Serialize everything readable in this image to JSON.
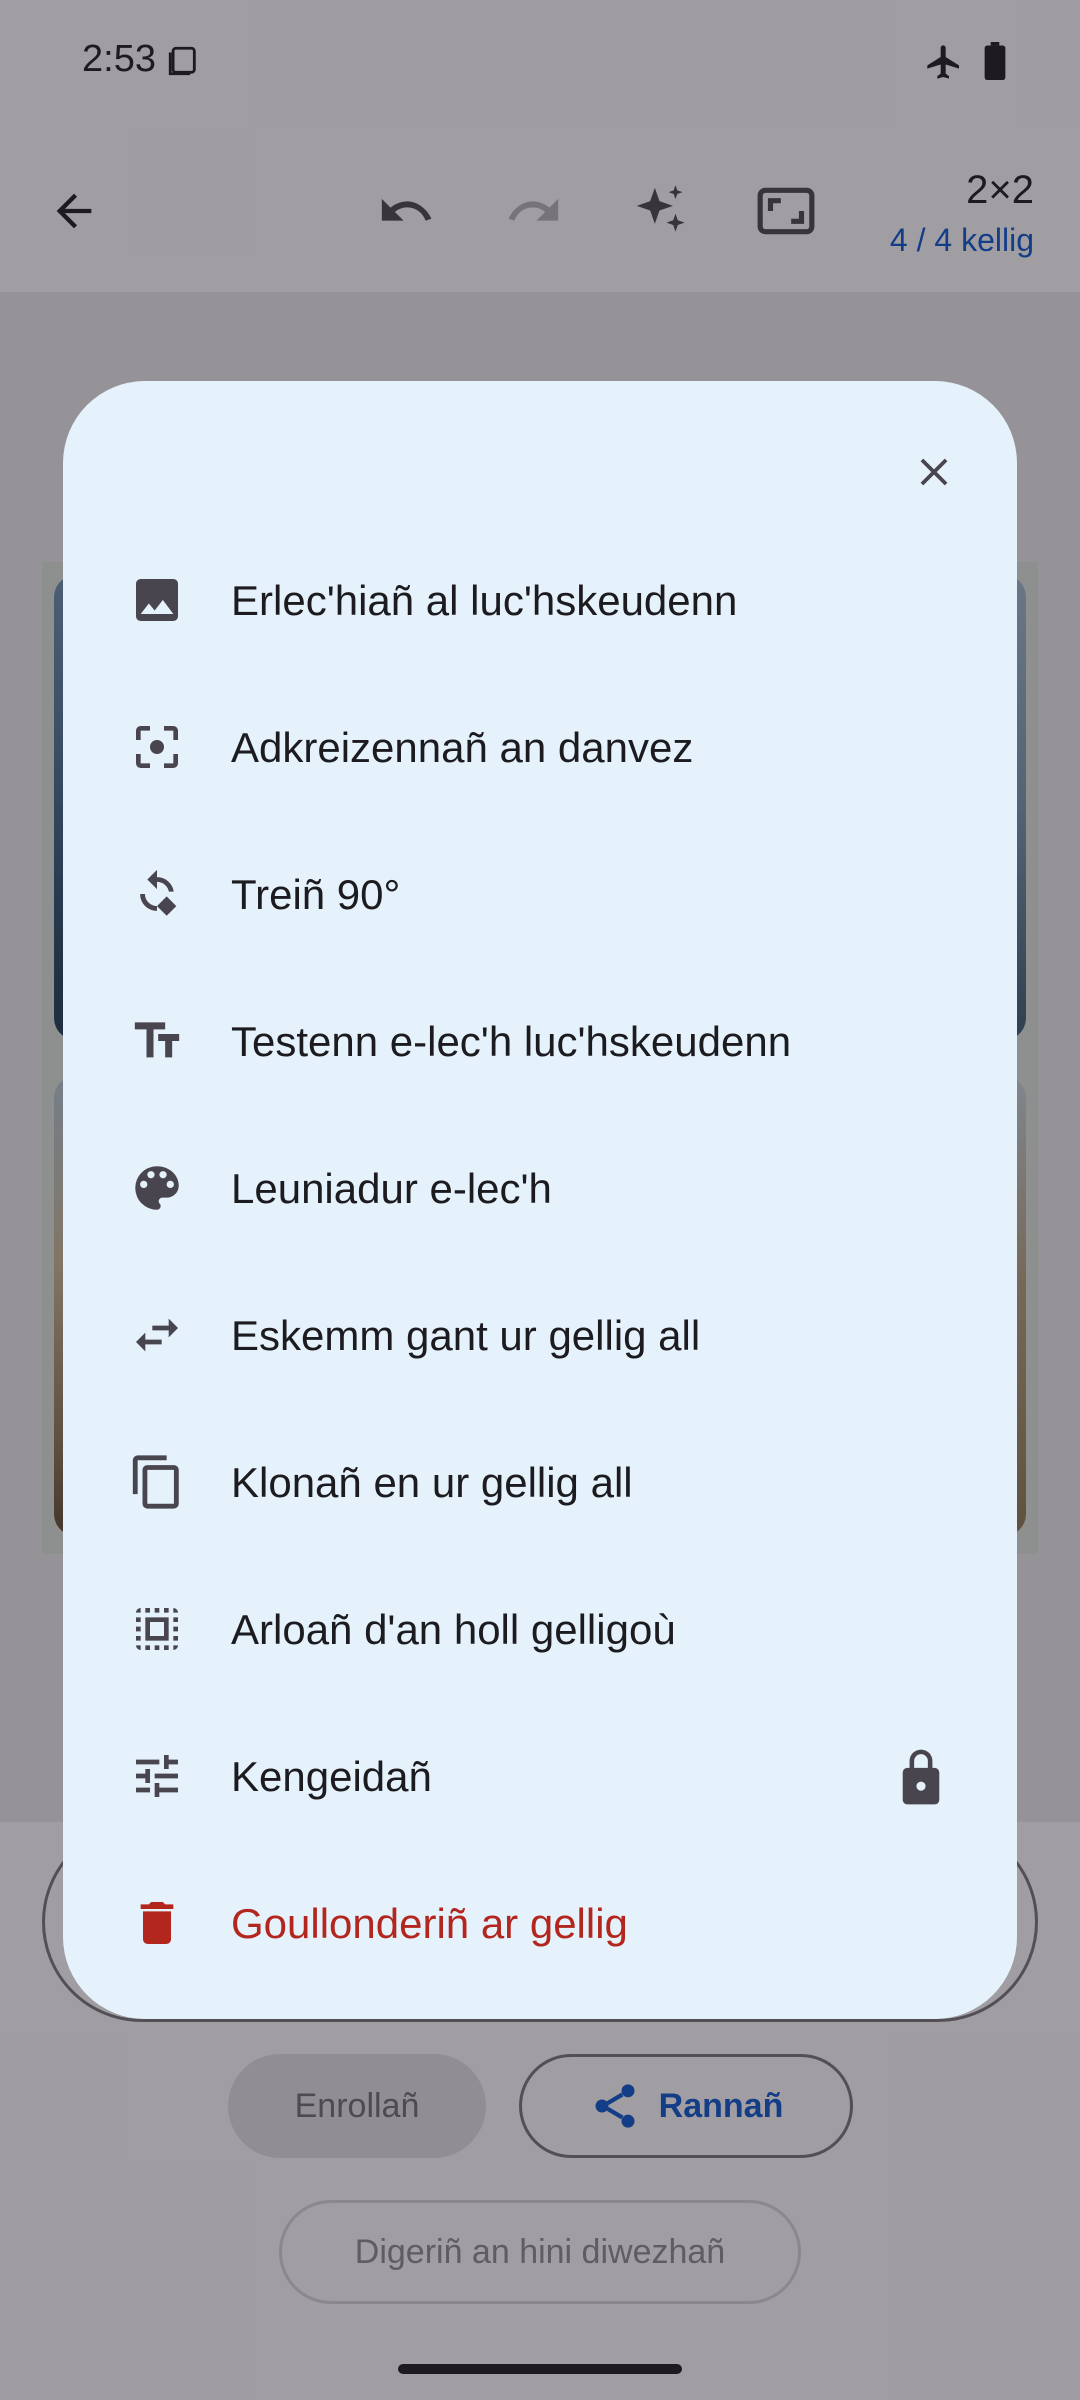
{
  "status_bar": {
    "time": "2:53",
    "icons": [
      "notification-icon",
      "airplane-mode-icon",
      "battery-icon"
    ]
  },
  "toolbar": {
    "back_icon": "arrow-back-icon",
    "undo_icon": "undo-icon",
    "redo_icon": "redo-icon",
    "magic_icon": "sparkle-icon",
    "aspect_icon": "aspect-ratio-icon",
    "grid_size": "2×2",
    "cell_count": "4 / 4 kellig"
  },
  "bottom_actions": {
    "save_label": "Enrollañ",
    "share_label": "Rannañ",
    "open_last_label": "Digeriñ an hini diwezhañ"
  },
  "dialog": {
    "close_icon": "close-icon",
    "items": [
      {
        "icon": "image-icon",
        "label": "Erlec'hiañ al luc'hskeudenn"
      },
      {
        "icon": "center-focus-icon",
        "label": "Adkreizennañ an danvez"
      },
      {
        "icon": "rotate-icon",
        "label": "Treiñ 90°"
      },
      {
        "icon": "text-size-icon",
        "label": "Testenn e-lec'h luc'hskeudenn"
      },
      {
        "icon": "palette-icon",
        "label": "Leuniadur e-lec'h"
      },
      {
        "icon": "swap-icon",
        "label": "Eskemm gant ur gellig all"
      },
      {
        "icon": "copy-icon",
        "label": "Klonañ en ur gellig all"
      },
      {
        "icon": "select-all-icon",
        "label": "Arloañ d'an holl gelligoù"
      },
      {
        "icon": "tune-icon",
        "label": "Kengeidañ",
        "locked": true
      },
      {
        "icon": "delete-icon",
        "label": "Goullonderiñ ar gellig",
        "danger": true
      }
    ]
  },
  "colors": {
    "dialog_bg": "#e5f1fb",
    "danger": "#b3261e",
    "accent": "#0b57d0"
  }
}
